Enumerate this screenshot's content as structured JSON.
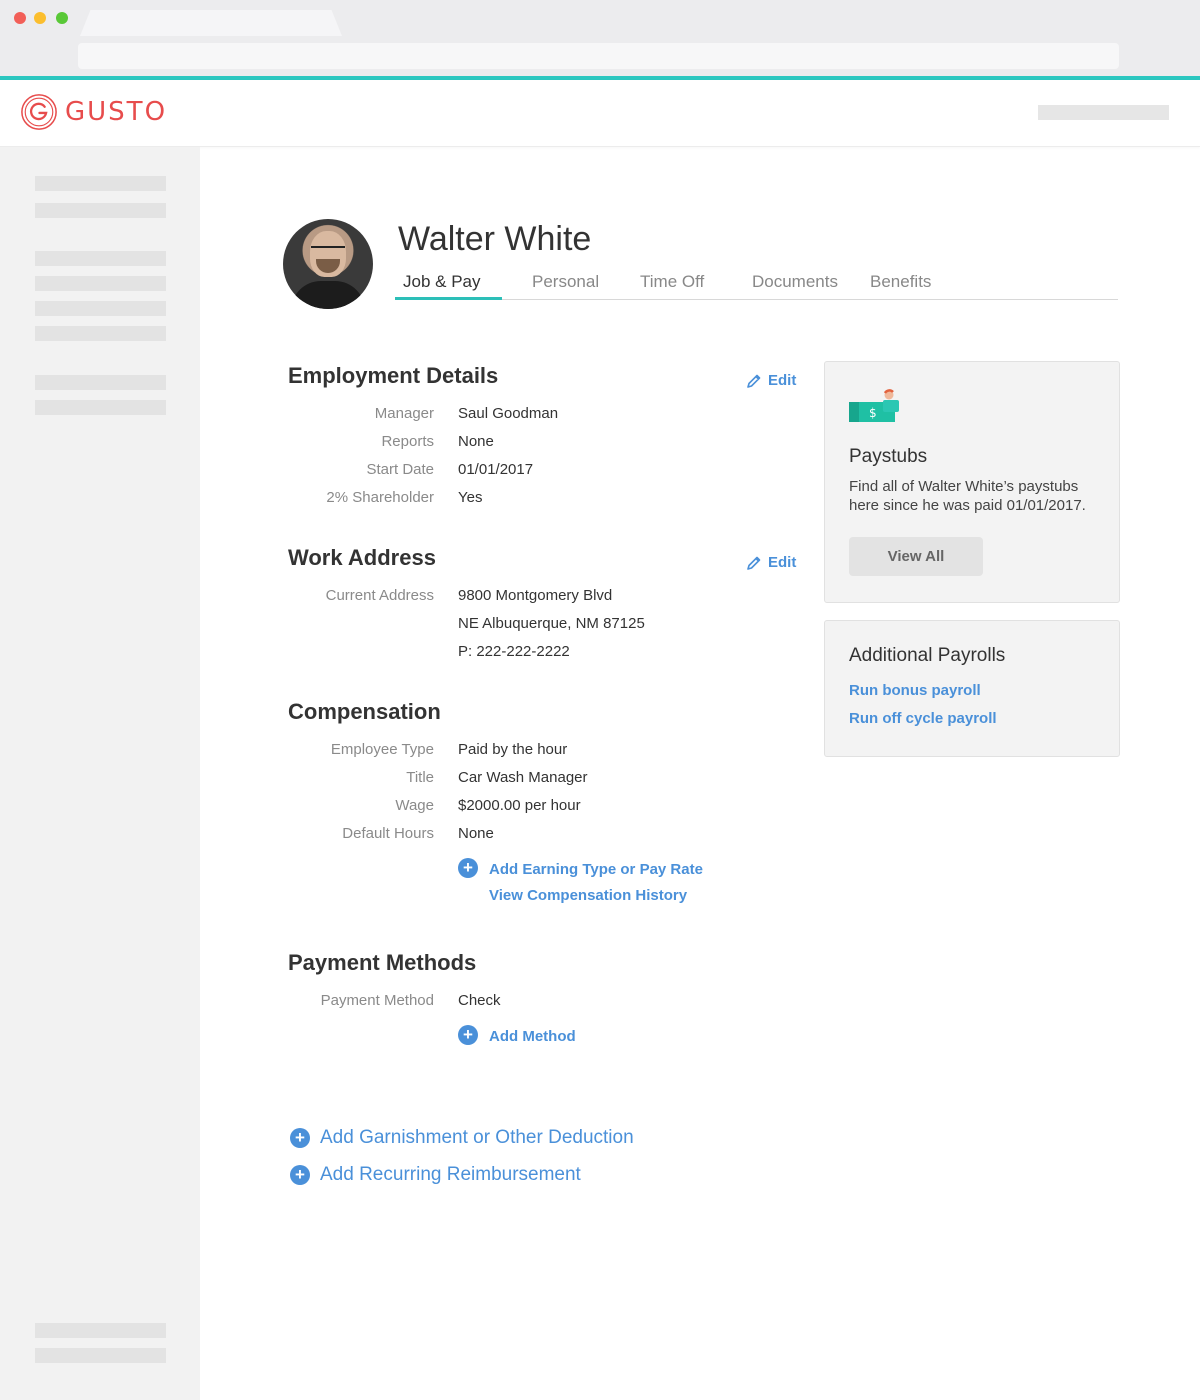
{
  "brand": {
    "name": "GUSTO",
    "color": "#e74c4c",
    "accent": "#2cc7c0",
    "link_color": "#4a90d9"
  },
  "employee": {
    "name": "Walter White"
  },
  "tabs": [
    {
      "label": "Job & Pay",
      "active": true
    },
    {
      "label": "Personal"
    },
    {
      "label": "Time Off"
    },
    {
      "label": "Documents"
    },
    {
      "label": "Benefits"
    }
  ],
  "employment": {
    "title": "Employment Details",
    "edit_label": "Edit",
    "rows": [
      {
        "label": "Manager",
        "value": "Saul Goodman"
      },
      {
        "label": "Reports",
        "value": "None"
      },
      {
        "label": "Start Date",
        "value": "01/01/2017"
      },
      {
        "label": "2% Shareholder",
        "value": "Yes"
      }
    ]
  },
  "work_address": {
    "title": "Work Address",
    "edit_label": "Edit",
    "label": "Current Address",
    "lines": [
      "9800 Montgomery Blvd",
      "NE Albuquerque, NM 87125",
      "P: 222-222-2222"
    ]
  },
  "compensation": {
    "title": "Compensation",
    "rows": [
      {
        "label": "Employee Type",
        "value": "Paid by the hour"
      },
      {
        "label": "Title",
        "value": "Car Wash Manager"
      },
      {
        "label": "Wage",
        "value": "$2000.00 per hour"
      },
      {
        "label": "Default Hours",
        "value": "None"
      }
    ],
    "add_link": "Add Earning Type or Pay Rate",
    "history_link": "View Compensation History"
  },
  "payment": {
    "title": "Payment Methods",
    "label": "Payment Method",
    "value": "Check",
    "add_link": "Add Method"
  },
  "actions": {
    "garnishment": "Add Garnishment or Other Deduction",
    "reimbursement": "Add Recurring Reimbursement"
  },
  "paystubs_card": {
    "icon": "money-icon",
    "title": "Paystubs",
    "text": "Find all of Walter White’s paystubs here since he was paid 01/01/2017.",
    "button": "View All"
  },
  "payrolls_card": {
    "title": "Additional Payrolls",
    "links": [
      "Run bonus payroll",
      "Run off cycle payroll"
    ]
  }
}
